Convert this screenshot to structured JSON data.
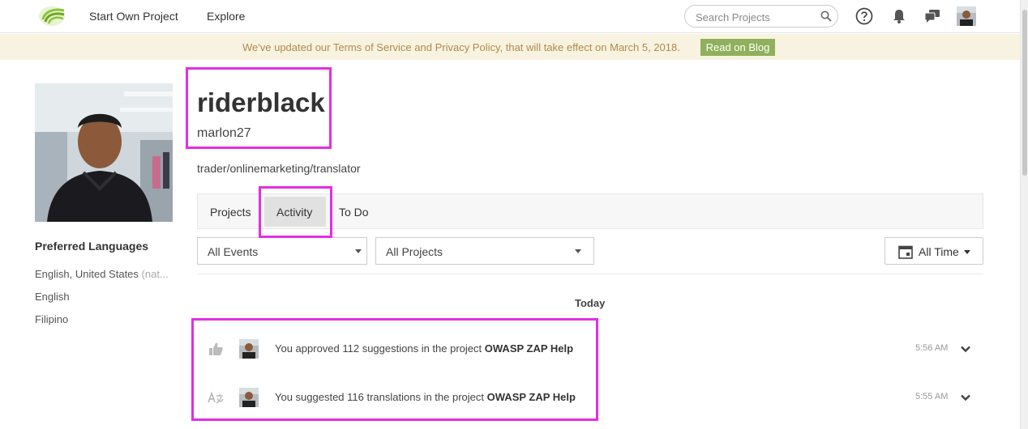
{
  "nav": {
    "start_project": "Start Own Project",
    "explore": "Explore",
    "search_placeholder": "Search Projects"
  },
  "banner": {
    "text": "We've updated our Terms of Service and Privacy Policy, that will take effect on March 5, 2018.",
    "button": "Read on Blog"
  },
  "profile": {
    "display_name": "riderblack",
    "username": "marlon27",
    "bio": "trader/onlinemarketing/translator"
  },
  "languages": {
    "title": "Preferred Languages",
    "items": [
      {
        "name": "English, United States",
        "note": "(nat..."
      },
      {
        "name": "English"
      },
      {
        "name": "Filipino"
      }
    ]
  },
  "tabs": [
    "Projects",
    "Activity",
    "To Do"
  ],
  "active_tab": "Activity",
  "filters": {
    "events": "All Events",
    "projects": "All Projects",
    "time": "All Time"
  },
  "feed": {
    "day": "Today",
    "items": [
      {
        "icon": "thumbs-up-icon",
        "prefix": "You approved 112 suggestions in the project",
        "project": "OWASP ZAP Help",
        "time": "5:56 AM"
      },
      {
        "icon": "translate-icon",
        "prefix": "You suggested 116 translations in the project",
        "project": "OWASP ZAP Help",
        "time": "5:55 AM"
      }
    ]
  },
  "colors": {
    "highlight": "#e22fe3",
    "banner_bg": "#f8f3e1",
    "banner_text": "#b08a4a",
    "banner_button": "#8fb05c",
    "logo_green": "#8ec33c"
  }
}
